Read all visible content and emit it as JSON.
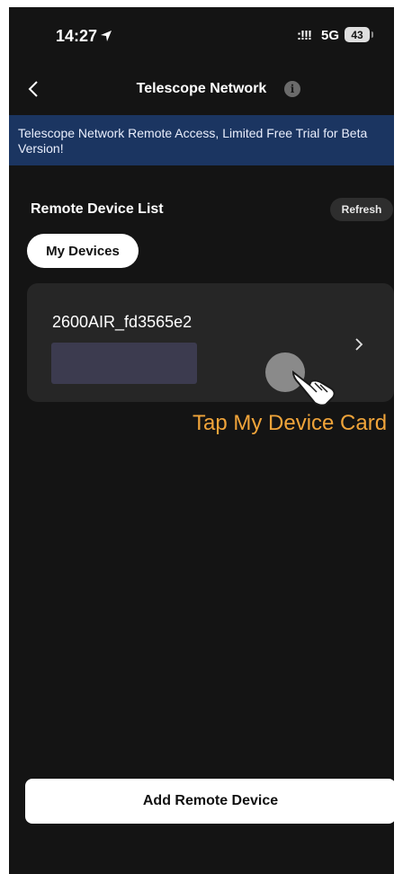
{
  "status_bar": {
    "time": "14:27",
    "signal": ":!!!",
    "network": "5G",
    "battery": "43"
  },
  "nav": {
    "title": "Telescope Network",
    "info_icon": "info-icon",
    "back_icon": "chevron-left-icon"
  },
  "banner": {
    "text": "Telescope Network Remote Access, Limited Free Trial for Beta Version!"
  },
  "device_list": {
    "title": "Remote Device List",
    "refresh_label": "Refresh",
    "tab_label": "My Devices",
    "devices": [
      {
        "name": "2600AIR_fd3565e2"
      }
    ]
  },
  "hint": {
    "text": "Tap My Device Card"
  },
  "footer": {
    "add_label": "Add Remote Device"
  },
  "colors": {
    "background": "#141414",
    "banner": "#1b3561",
    "card": "#262626",
    "hint": "#f0a43a"
  }
}
